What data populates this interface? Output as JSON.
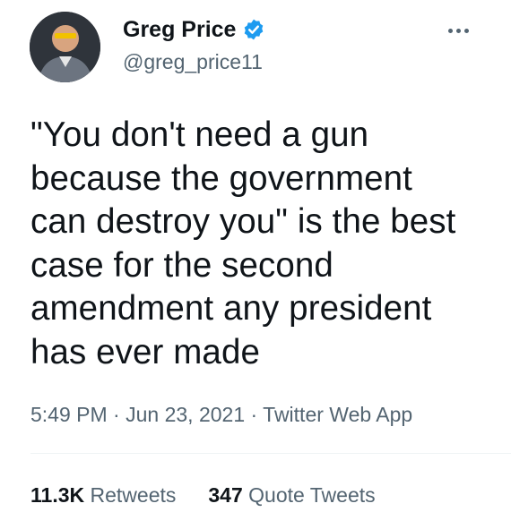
{
  "author": {
    "display_name": "Greg Price",
    "handle": "@greg_price11",
    "verified": true,
    "avatar_icon": "person-avatar"
  },
  "tweet": {
    "text_lines": [
      "\"You don't need a gun",
      "because the government",
      "can destroy you\" is the best",
      "case for the second",
      "amendment any president",
      "has ever made"
    ],
    "time": "5:49 PM",
    "separator": "·",
    "date": "Jun 23, 2021",
    "source": "Twitter Web App"
  },
  "stats": {
    "retweets_count": "11.3K",
    "retweets_label": "Retweets",
    "quote_count": "347",
    "quote_label": "Quote Tweets"
  },
  "colors": {
    "text": "#0f1419",
    "secondary": "#536471",
    "verified_blue": "#1d9bf0",
    "divider": "#eff3f4"
  }
}
